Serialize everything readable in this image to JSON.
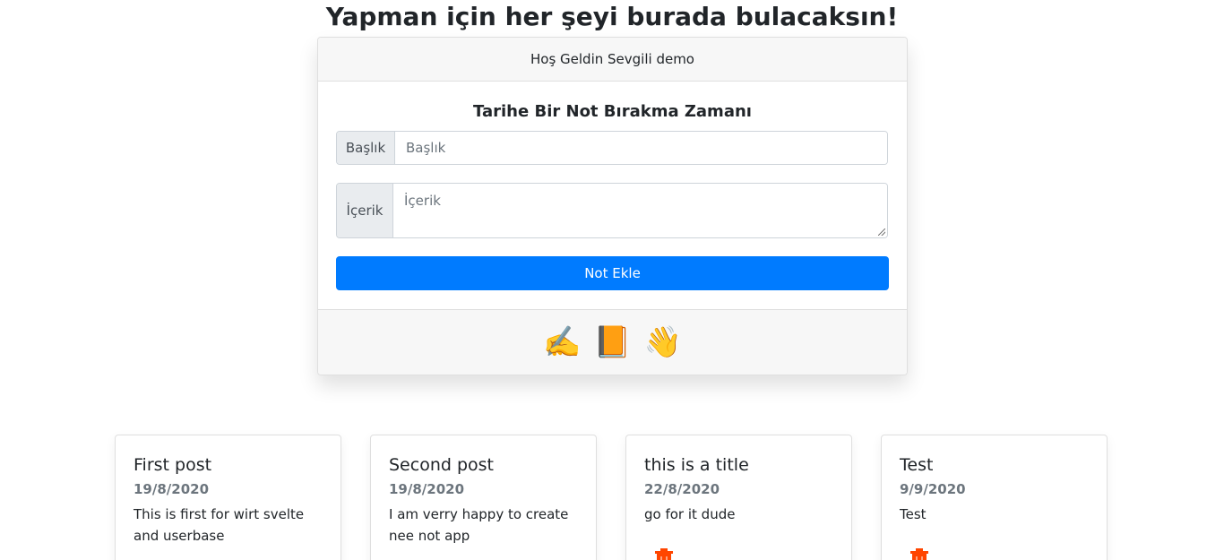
{
  "header": {
    "title": "Yapman için her şeyi burada bulacaksın!"
  },
  "note_card": {
    "welcome": "Hoş Geldin Sevgili demo",
    "form_title": "Tarihe Bir Not Bırakma Zamanı",
    "title_field": {
      "label": "Başlık",
      "placeholder": "Başlık",
      "value": ""
    },
    "content_field": {
      "label": "İçerik",
      "placeholder": "İçerik",
      "value": ""
    },
    "submit_label": "Not Ekle",
    "footer_emojis": [
      "✍️",
      "📙",
      "👋"
    ]
  },
  "posts": [
    {
      "title": "First post",
      "date": "19/8/2020",
      "content": "This is first for wirt svelte and userbase",
      "delete_icon": "trash-icon"
    },
    {
      "title": "Second post",
      "date": "19/8/2020",
      "content": "I am verry happy to create nee not app",
      "delete_icon": "trash-icon"
    },
    {
      "title": "this is a title",
      "date": "22/8/2020",
      "content": "go for it dude",
      "delete_icon": "trash-icon"
    },
    {
      "title": "Test",
      "date": "9/9/2020",
      "content": "Test",
      "delete_icon": "trash-icon"
    }
  ],
  "colors": {
    "primary": "#007bff",
    "header_bg": "#f7f7f7",
    "addon_bg": "#e9ecef",
    "muted_text": "#6c757d",
    "delete_icon": "#ff4500"
  }
}
